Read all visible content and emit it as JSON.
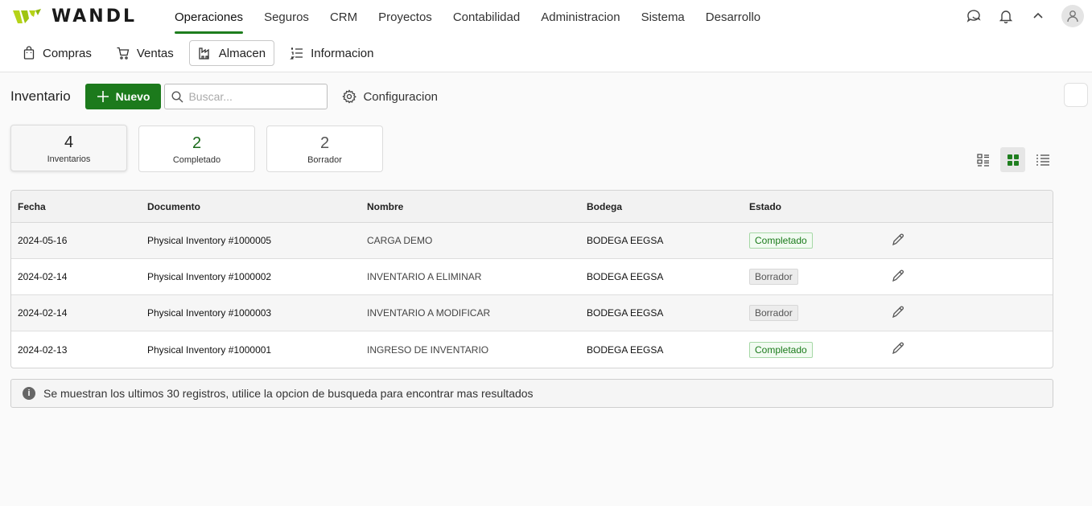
{
  "brand": {
    "name": "WANDL",
    "accent": "#1e7e1e",
    "logo_color": "#b5d319"
  },
  "main_nav": [
    {
      "label": "Operaciones",
      "active": true
    },
    {
      "label": "Seguros"
    },
    {
      "label": "CRM"
    },
    {
      "label": "Proyectos"
    },
    {
      "label": "Contabilidad"
    },
    {
      "label": "Administracion"
    },
    {
      "label": "Sistema"
    },
    {
      "label": "Desarrollo"
    }
  ],
  "top_icons": [
    "chat-icon",
    "bell-icon",
    "chevron-up-icon",
    "user-avatar-icon"
  ],
  "sub_nav": [
    {
      "label": "Compras",
      "icon": "bag-icon"
    },
    {
      "label": "Ventas",
      "icon": "cart-icon"
    },
    {
      "label": "Almacen",
      "icon": "warehouse-icon",
      "active": true
    },
    {
      "label": "Informacion",
      "icon": "list-icon"
    }
  ],
  "toolbar": {
    "title": "Inventario",
    "new_label": "Nuevo",
    "search_placeholder": "Buscar...",
    "config_label": "Configuracion"
  },
  "stats": [
    {
      "value": "4",
      "label": "Inventarios",
      "color": "#222222",
      "active": true
    },
    {
      "value": "2",
      "label": "Completado",
      "color": "#1a6a1a"
    },
    {
      "value": "2",
      "label": "Borrador",
      "color": "#555555"
    }
  ],
  "view_toggles": [
    "card-view-icon",
    "grid-view-icon",
    "list-view-icon"
  ],
  "table": {
    "columns": [
      "Fecha",
      "Documento",
      "Nombre",
      "Bodega",
      "Estado",
      ""
    ],
    "rows": [
      {
        "fecha": "2024-05-16",
        "documento": "Physical Inventory #1000005",
        "nombre": "CARGA DEMO",
        "bodega": "BODEGA EEGSA",
        "estado": "Completado",
        "status": "green"
      },
      {
        "fecha": "2024-02-14",
        "documento": "Physical Inventory #1000002",
        "nombre": "INVENTARIO A ELIMINAR",
        "bodega": "BODEGA EEGSA",
        "estado": "Borrador",
        "status": "grey"
      },
      {
        "fecha": "2024-02-14",
        "documento": "Physical Inventory #1000003",
        "nombre": "INVENTARIO A MODIFICAR",
        "bodega": "BODEGA EEGSA",
        "estado": "Borrador",
        "status": "grey"
      },
      {
        "fecha": "2024-02-13",
        "documento": "Physical Inventory #1000001",
        "nombre": "INGRESO DE INVENTARIO",
        "bodega": "BODEGA EEGSA",
        "estado": "Completado",
        "status": "green"
      }
    ]
  },
  "info_message": "Se muestran los ultimos 30 registros, utilice la opcion de busqueda para encontrar mas resultados"
}
